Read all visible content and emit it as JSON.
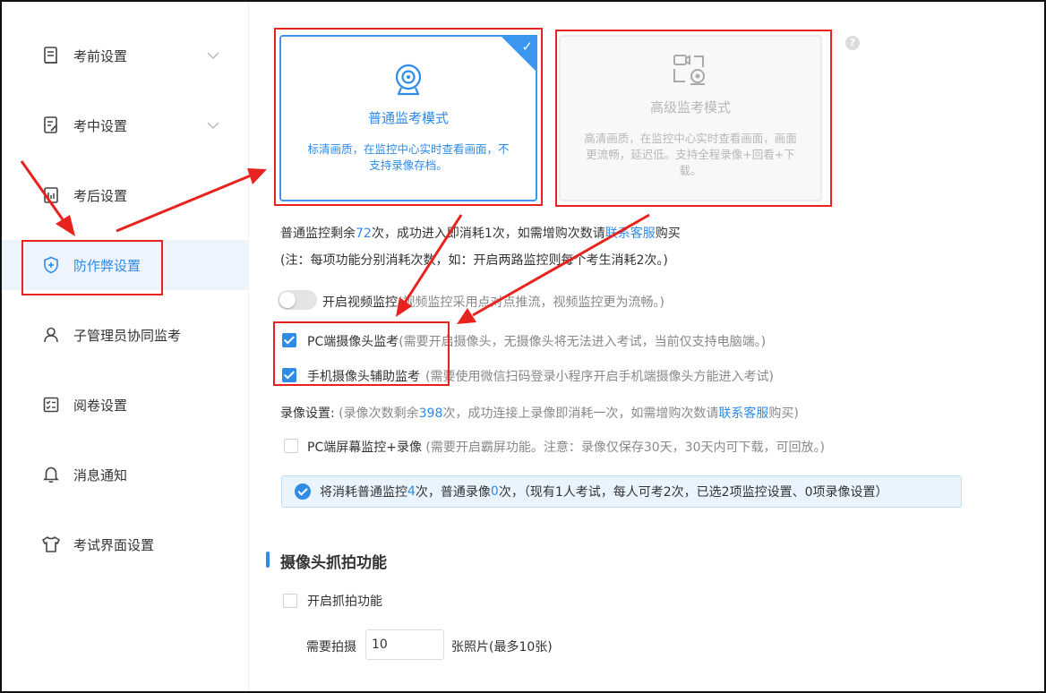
{
  "sidebar": {
    "items": [
      {
        "label": "考前设置",
        "icon": "document-icon"
      },
      {
        "label": "考中设置",
        "icon": "edit-document-icon"
      },
      {
        "label": "考后设置",
        "icon": "report-icon"
      },
      {
        "label": "防作弊设置",
        "icon": "shield-icon"
      },
      {
        "label": "子管理员协同监考",
        "icon": "user-icon"
      },
      {
        "label": "阅卷设置",
        "icon": "checklist-icon"
      },
      {
        "label": "消息通知",
        "icon": "bell-icon"
      },
      {
        "label": "考试界面设置",
        "icon": "shirt-icon"
      }
    ],
    "active_index": 3
  },
  "mode_cards": {
    "normal": {
      "title": "普通监考模式",
      "desc": "标清画质，在监控中心实时查看画面，不支持录像存档。",
      "icon": "webcam-icon",
      "selected": true
    },
    "advanced": {
      "title": "高级监考模式",
      "desc": "高清画质，在监控中心实时查看画面，画面更流畅，延迟低。支持全程录像+回看+下载。",
      "icon": "camera-record-icon",
      "selected": false
    }
  },
  "quota": {
    "prefix": "普通监控剩余",
    "count": "72",
    "suffix": "次，成功进入即消耗1次，如需增购次数请",
    "link": "联系客服",
    "tail": "购买",
    "note": "(注：每项功能分别消耗次数，如：开启两路监控则每个考生消耗2次。)"
  },
  "video_toggle": {
    "label": "开启视频监控",
    "hint": "(视频监控采用点对点推流，视频监控更为流畅。)",
    "on": false
  },
  "pc_camera": {
    "label": "PC端摄像头监考",
    "hint": "(需要开启摄像头，无摄像头将无法进入考试，当前仅支持电脑端。)",
    "checked": true
  },
  "mobile_camera": {
    "label": "手机摄像头辅助监考",
    "hint": "(需要使用微信扫码登录小程序开启手机端摄像头方能进入考试)",
    "checked": true
  },
  "record": {
    "label": "录像设置:",
    "prefix": "(录像次数剩余",
    "count": "398",
    "suffix": "次，成功连接上录像即消耗一次，如需增购次数请",
    "link": "联系客服",
    "tail": "购买)"
  },
  "pc_screen": {
    "label": "PC端屏幕监控+录像",
    "hint": "(需要开启霸屏功能。注意：录像仅保存30天，30天内可下载，可回放。)",
    "checked": false
  },
  "notice": {
    "p1": "将消耗普通监控",
    "n1": "4",
    "p2": "次，普通录像",
    "n2": "0",
    "p3": "次，（现有1人考试，每人可考2次，已选2项监控设置、0项录像设置）"
  },
  "capture": {
    "section_title": "摄像头抓拍功能",
    "enable_label": "开启抓拍功能",
    "enabled": false,
    "need_label": "需要拍摄",
    "count_value": "10",
    "unit_label": "张照片(最多10张)"
  },
  "help_icon": "?",
  "accent_color": "#2e8be8",
  "annotation_color": "#e8231f"
}
